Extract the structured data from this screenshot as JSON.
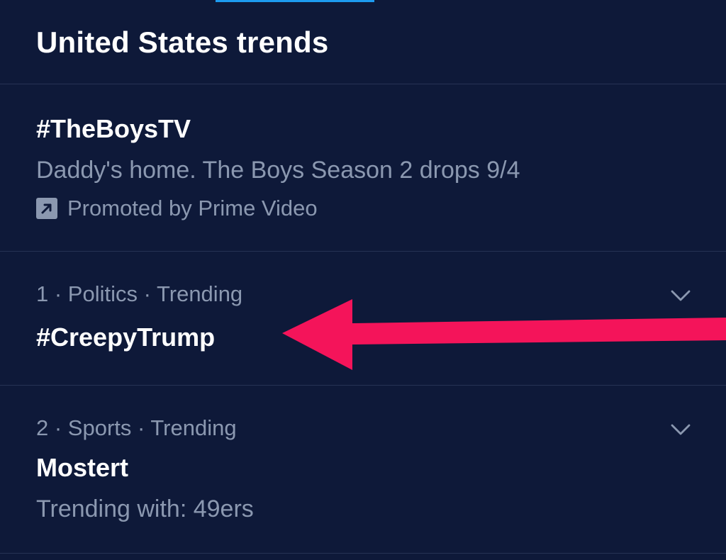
{
  "header": {
    "title": "United States trends"
  },
  "promoted_trend": {
    "name": "#TheBoysTV",
    "description": "Daddy's home. The Boys Season 2 drops 9/4",
    "promoted_label": "Promoted by Prime Video",
    "icon": "promoted-arrow-icon"
  },
  "trends": [
    {
      "meta": "1 · Politics · Trending",
      "name": "#CreepyTrump",
      "icon": "chevron-down-icon"
    },
    {
      "meta": "2 · Sports · Trending",
      "name": "Mostert",
      "subtext": "Trending with: 49ers",
      "icon": "chevron-down-icon"
    }
  ],
  "colors": {
    "background": "#0e1939",
    "divider": "#263254",
    "primary_text": "#ffffff",
    "secondary_text": "#8b98b0",
    "accent": "#1d9bf0",
    "annotation_arrow": "#f4145a"
  },
  "annotation": {
    "icon": "red-arrow-icon"
  }
}
